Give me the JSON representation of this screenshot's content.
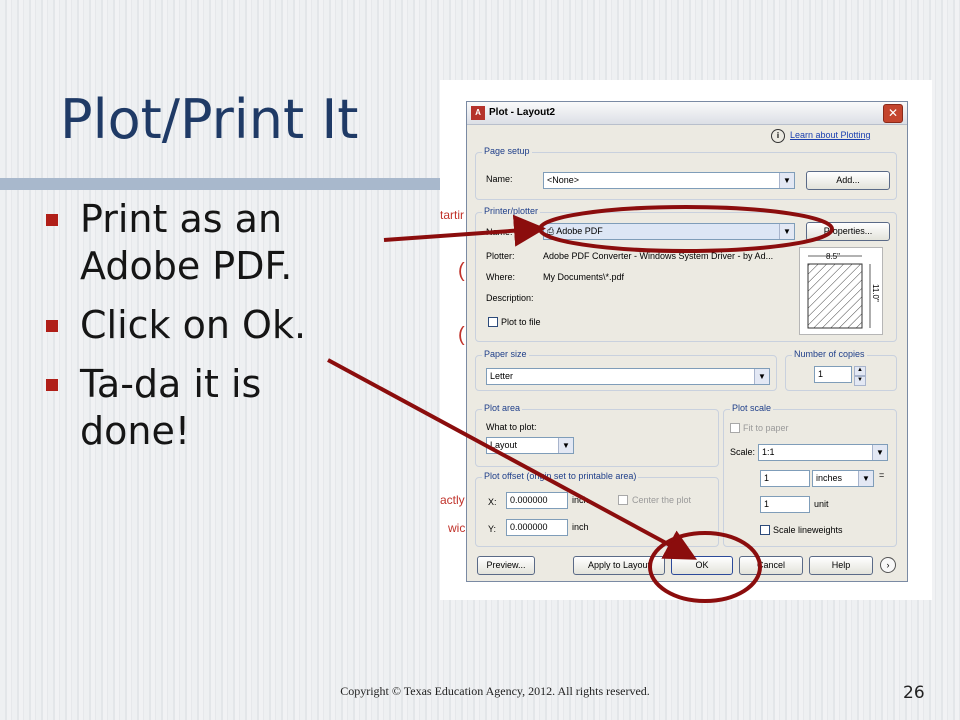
{
  "slide": {
    "title": "Plot/Print It",
    "bullets": [
      "Print as an Adobe PDF.",
      "Click on Ok.",
      "Ta-da it is done!"
    ],
    "footer": "Copyright © Texas Education Agency, 2012. All rights reserved.",
    "page_number": "26",
    "accent_color": "#b01e18",
    "title_color": "#1f3a66",
    "annotation_color": "#8b0d0d"
  },
  "background_fragments": [
    "tartir",
    "actly",
    "wic"
  ],
  "dialog": {
    "app_icon": "A",
    "title": "Plot - Layout2",
    "close_glyph": "✕",
    "learn_link": "Learn about Plotting",
    "info_glyph": "i",
    "page_setup": {
      "legend": "Page setup",
      "name_label": "Name:",
      "name_value": "<None>",
      "add_button": "Add..."
    },
    "printer": {
      "legend": "Printer/plotter",
      "name_label": "Name:",
      "name_value": "Adobe PDF",
      "properties_button": "Properties...",
      "plotter_label": "Plotter:",
      "plotter_value": "Adobe PDF Converter - Windows System Driver - by Ad...",
      "where_label": "Where:",
      "where_value": "My Documents\\*.pdf",
      "description_label": "Description:",
      "plot_to_file_label": "Plot to file",
      "paper_width": "8.5\"",
      "paper_height": "11.0\""
    },
    "paper_size": {
      "legend": "Paper size",
      "value": "Letter"
    },
    "copies": {
      "legend": "Number of copies",
      "value": "1"
    },
    "plot_area": {
      "legend": "Plot area",
      "what_label": "What to plot:",
      "what_value": "Layout"
    },
    "plot_scale": {
      "legend": "Plot scale",
      "fit_label": "Fit to paper",
      "scale_label": "Scale:",
      "scale_value": "1:1",
      "units_value": "1",
      "units_unit": "inches",
      "equals": "=",
      "unit_value": "1",
      "unit_label": "unit",
      "lineweights_label": "Scale lineweights"
    },
    "plot_offset": {
      "legend": "Plot offset (origin set to printable area)",
      "x_label": "X:",
      "x_value": "0.000000",
      "x_unit": "inch",
      "y_label": "Y:",
      "y_value": "0.000000",
      "y_unit": "inch",
      "center_label": "Center the plot"
    },
    "buttons": {
      "preview": "Preview...",
      "apply": "Apply to Layout",
      "ok": "OK",
      "cancel": "Cancel",
      "help": "Help",
      "expand_glyph": "›"
    },
    "arrow_glyph": "▼",
    "spin_up": "▲",
    "spin_down": "▼"
  }
}
